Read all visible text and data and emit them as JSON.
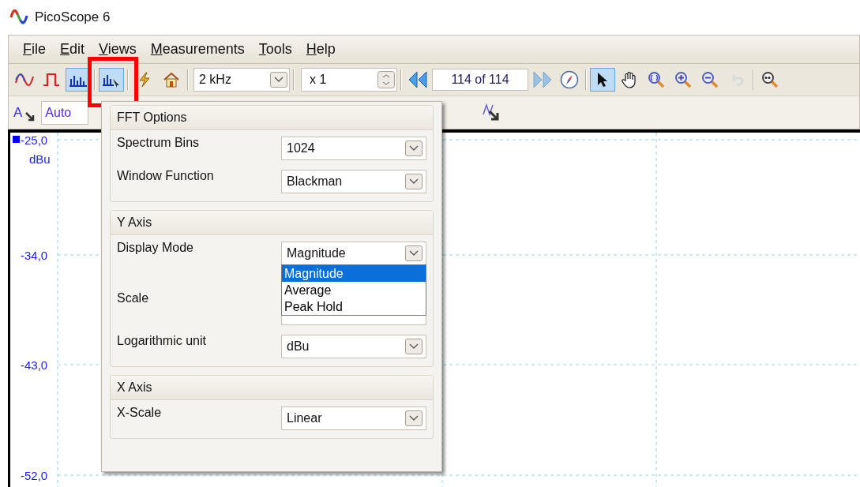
{
  "window": {
    "title": "PicoScope 6"
  },
  "menu": [
    {
      "label": "File"
    },
    {
      "label": "Edit"
    },
    {
      "label": "Views"
    },
    {
      "label": "Measurements"
    },
    {
      "label": "Tools"
    },
    {
      "label": "Help"
    }
  ],
  "toolbar": {
    "mode_buttons": [
      {
        "kind": "scope",
        "selected": false
      },
      {
        "kind": "persistence",
        "selected": false
      },
      {
        "kind": "spectrum",
        "selected": true
      }
    ],
    "options_button": {
      "selected": true,
      "highlighted": true
    },
    "action_buttons": [
      {
        "kind": "lightning"
      },
      {
        "kind": "home"
      }
    ],
    "frequency": {
      "value": "2 kHz"
    },
    "multiplier": {
      "value": "x 1"
    },
    "buffer": {
      "value": "114 of 114",
      "back_disabled": false,
      "forward_disabled": true
    },
    "tools": [
      {
        "kind": "pointer",
        "selected": true,
        "disabled": false
      },
      {
        "kind": "hand",
        "selected": false,
        "disabled": false
      },
      {
        "kind": "zoom-fit",
        "selected": false,
        "disabled": false
      },
      {
        "kind": "zoom-in",
        "selected": false,
        "disabled": false
      },
      {
        "kind": "zoom-out",
        "selected": false,
        "disabled": false
      },
      {
        "kind": "undo",
        "selected": false,
        "disabled": true
      }
    ]
  },
  "channel_bar": {
    "channel": "A",
    "range": "Auto"
  },
  "plot": {
    "unit": "dBu",
    "y_labels": [
      "-25,0",
      "-34,0",
      "-43,0",
      "-52,0"
    ]
  },
  "fft_options": {
    "title": "FFT Options",
    "sections": [
      {
        "rows": [
          {
            "label": "Spectrum Bins",
            "value": "1024"
          },
          {
            "label": "Window Function",
            "value": "Blackman"
          }
        ]
      },
      {
        "title": "Y Axis",
        "rows": [
          {
            "label": "Display Mode",
            "value": "Magnitude",
            "open": true,
            "options": [
              {
                "label": "Magnitude",
                "selected": true
              },
              {
                "label": "Average",
                "selected": false
              },
              {
                "label": "Peak Hold",
                "selected": false
              }
            ]
          },
          {
            "label": "Scale",
            "kind": "covered"
          },
          {
            "label": "Logarithmic unit",
            "value": "dBu"
          }
        ]
      },
      {
        "title": "X Axis",
        "rows": [
          {
            "label": "X-Scale",
            "value": "Linear"
          }
        ]
      }
    ]
  }
}
